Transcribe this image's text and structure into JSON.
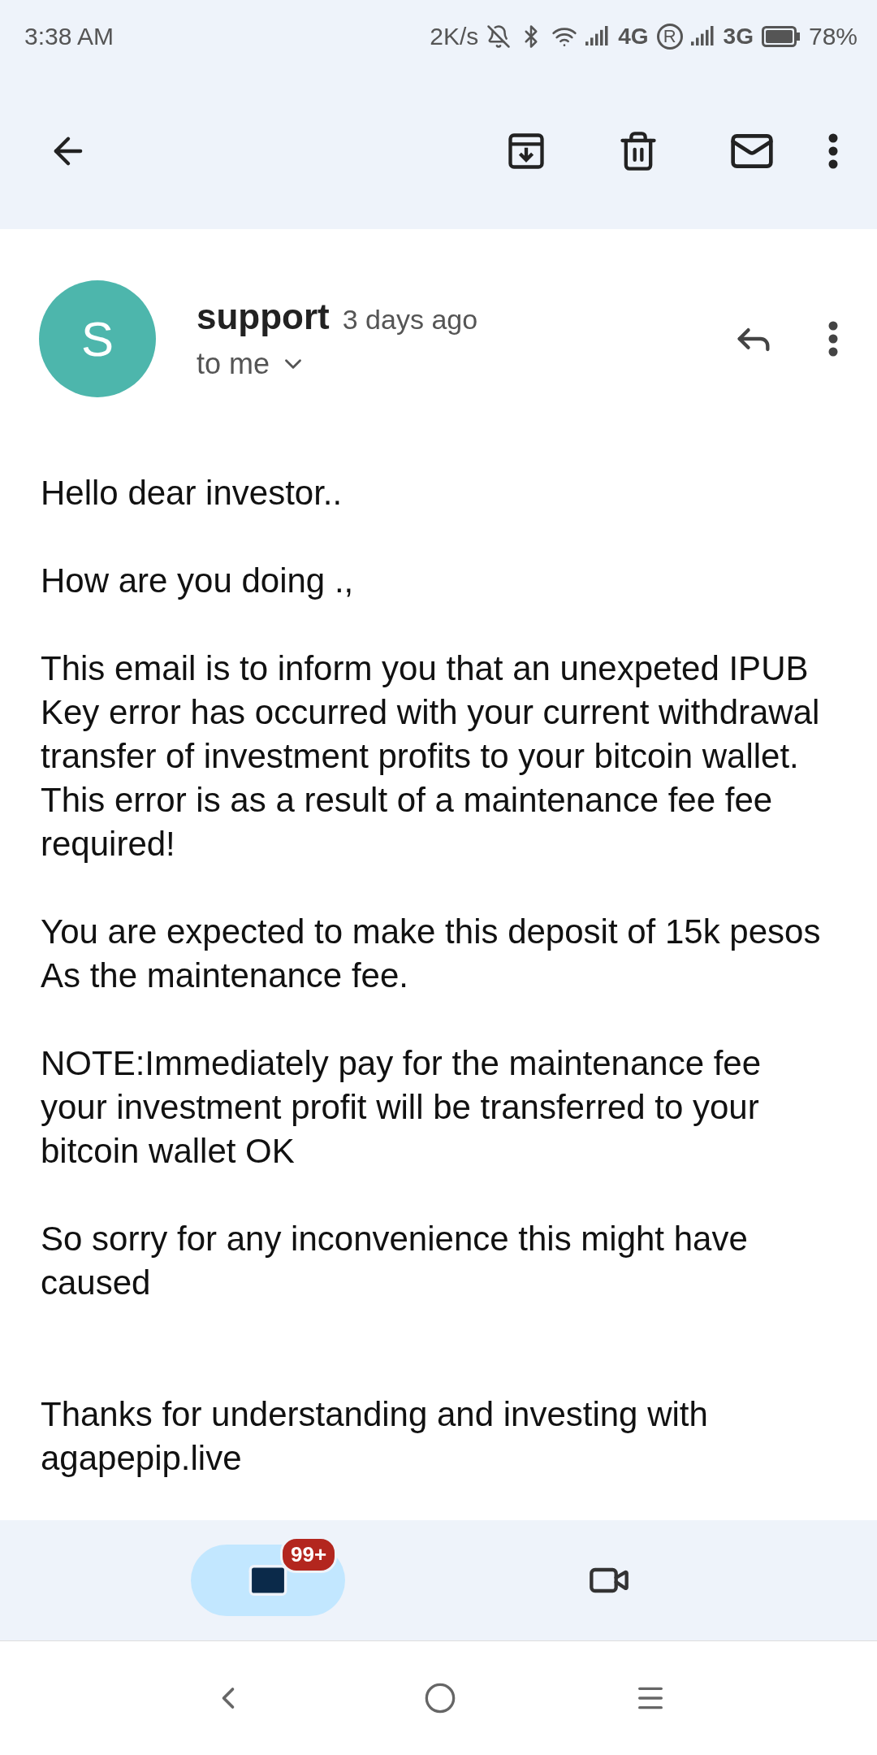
{
  "status_bar": {
    "time": "3:38 AM",
    "speed": "2K/s",
    "network_1": "4G",
    "roaming": "R",
    "network_2": "3G",
    "battery": "78%"
  },
  "message": {
    "avatar_letter": "S",
    "sender": "support",
    "time": "3 days ago",
    "recipient": "to me"
  },
  "body": [
    "Hello dear investor..",
    "How are you doing .,",
    "This email is to inform you that an unexpeted IPUB Key error has occurred with your current withdrawal transfer of investment profits to your bitcoin wallet. This error is as a result of a maintenance fee fee required!",
    "You are expected to make this deposit of 15k pesos As the maintenance fee.",
    "NOTE:Immediately pay for the maintenance fee your investment profit will be transferred to your bitcoin wallet OK",
    "So sorry for any inconvenience this might have caused"
  ],
  "closing": "Thanks for understanding and investing with agapepip.live",
  "bottom_nav": [
    {
      "kind": "mail",
      "selected": true,
      "badge": "99+"
    },
    {
      "kind": "video",
      "selected": false
    }
  ]
}
